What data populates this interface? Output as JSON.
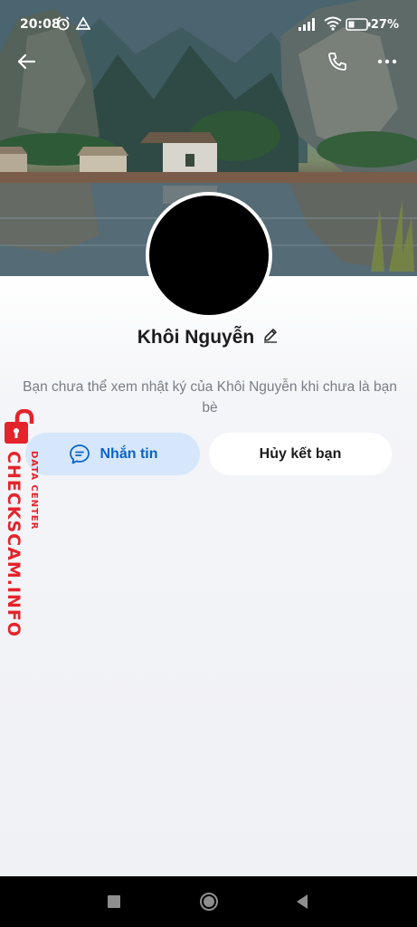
{
  "status_bar": {
    "time": "20:08",
    "battery": "27%"
  },
  "profile": {
    "name": "Khôi Nguyễn",
    "notice": "Bạn chưa thể xem nhật ký của Khôi Nguyễn khi chưa là bạn bè"
  },
  "actions": {
    "message_label": "Nhắn tin",
    "unfriend_label": "Hủy kết bạn"
  },
  "watermark": {
    "main": "CHECKSCAM.INFO",
    "sub": "DATA CENTER"
  },
  "colors": {
    "accent": "#0a63c9",
    "message_bg": "#d6e7fb",
    "watermark": "#e3242b"
  },
  "icons": [
    "back-arrow-icon",
    "phone-icon",
    "more-icon",
    "edit-pencil-icon",
    "chat-bubble-icon",
    "alarm-icon",
    "wifi-icon",
    "battery-icon",
    "signal-icon"
  ]
}
